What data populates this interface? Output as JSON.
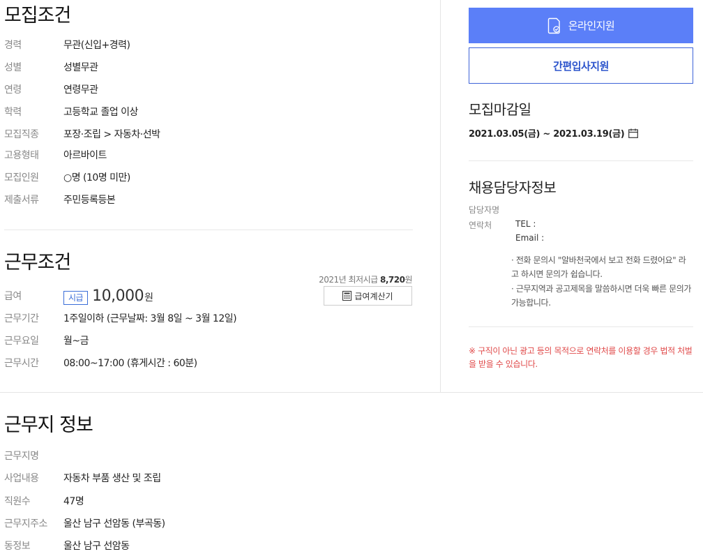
{
  "recruit": {
    "title": "모집조건",
    "rows": [
      {
        "label": "경력",
        "value": "무관(신입+경력)"
      },
      {
        "label": "성별",
        "value": "성별무관"
      },
      {
        "label": "연령",
        "value": "연령무관"
      },
      {
        "label": "학력",
        "value": "고등학교 졸업 이상"
      },
      {
        "label": "모집직종",
        "value": "포장·조립 > 자동차·선박"
      },
      {
        "label": "고용형태",
        "value": "아르바이트"
      },
      {
        "label": "모집인원",
        "value": "○명 (10명 미만)"
      },
      {
        "label": "제출서류",
        "value": "주민등록등본"
      }
    ]
  },
  "work": {
    "title": "근무조건",
    "min_wage_label": "2021년 최저시급",
    "min_wage_value": "8,720",
    "min_wage_unit": "원",
    "calc_button": "급여계산기",
    "wage_label": "급여",
    "wage_badge": "시급",
    "wage_amount": "10,000",
    "wage_unit": "원",
    "rows": [
      {
        "label": "근무기간",
        "value": "1주일이하 (근무날짜: 3월 8일 ~ 3월 12일)"
      },
      {
        "label": "근무요일",
        "value": "월~금"
      },
      {
        "label": "근무시간",
        "value": "08:00~17:00 (휴게시간 : 60분)"
      }
    ]
  },
  "sidebar": {
    "online_apply": "온라인지원",
    "simple_apply": "간편입사지원",
    "deadline_title": "모집마감일",
    "deadline": "2021.03.05(금) ~ 2021.03.19(금)",
    "contact_title": "채용담당자정보",
    "manager_label": "담당자명",
    "contact_label": "연락처",
    "tel": "TEL :",
    "email": "Email :",
    "notice1": "· 전화 문의시 \"알바천국에서 보고 전화 드렸어요\" 라고 하시면 문의가 쉽습니다.",
    "notice2": "· 근무지역과 공고제목을 말씀하시면 더욱 빠른 문의가 가능합니다.",
    "warning": "※ 구직이 아닌 광고 등의 목적으로 연락처를 이용할 경우 법적 처벌을 받을 수 있습니다.",
    "accent_color": "#5b7ff8",
    "warn_color": "#e04a4a"
  },
  "workplace": {
    "title": "근무지 정보",
    "rows": [
      {
        "label": "근무지명",
        "value": ""
      },
      {
        "label": "사업내용",
        "value": "자동차 부품 생산 및 조립"
      },
      {
        "label": "직원수",
        "value": "47명"
      },
      {
        "label": "근무지주소",
        "value": "울산 남구 선암동 (부곡동)"
      },
      {
        "label": "동정보",
        "value": "울산 남구 선암동"
      }
    ]
  }
}
